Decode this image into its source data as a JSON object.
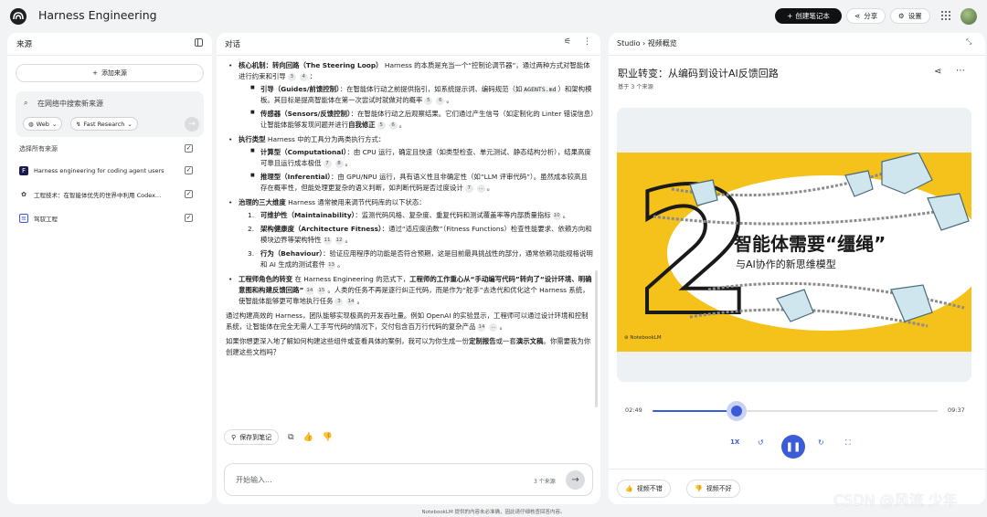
{
  "header": {
    "app_title": "Harness Engineering",
    "create_label": "创建笔记本",
    "share_label": "分享",
    "settings_label": "设置"
  },
  "sources": {
    "title": "来源",
    "add_label": "添加来源",
    "search_text": "在网络中搜索新来源",
    "web_chip": "Web",
    "research_chip": "Fast Research",
    "select_all": "选择所有来源",
    "items": [
      {
        "label": "Harness engineering for coding agent users",
        "icon": "file-icon"
      },
      {
        "label": "工程技术：在智能体优先的世界中利用 Codex...",
        "icon": "openai-icon"
      },
      {
        "label": "驾驭工程",
        "icon": "doc-icon"
      }
    ]
  },
  "chat": {
    "title": "对话",
    "b1_title": "核心机制：转向回路（The Steering Loop）",
    "b1_text": "Harness 的本质是充当一个“控制论调节器”，通过两种方式对智能体进行约束和引导",
    "b1_refs": [
      "3",
      "4"
    ],
    "b1_s1_title": "引导（Guides/前馈控制）",
    "b1_s1_text_a": "：在智能体行动之前提供指引，如系统提示词、编码规范（如",
    "b1_s1_code": "AGENTS.md",
    "b1_s1_text_b": "）和架构模板。其目标是提高智能体在第一次尝试时就做对的概率",
    "b1_s1_refs": [
      "5",
      "6"
    ],
    "b1_s2_title": "传感器（Sensors/反馈控制）",
    "b1_s2_text_a": "：在智能体行动之后观察结果。它们通过产生信号（如定制化的 Linter 错误信息）让智能体能够发现问题并进行",
    "b1_s2_bold": "自我修正",
    "b1_s2_refs": [
      "5",
      "6"
    ],
    "b2_title": "执行类型",
    "b2_text": " Harness 中的工具分为两类执行方式：",
    "b2_s1_title": "计算型（Computational）",
    "b2_s1_text": "：由 CPU 运行，确定且快速（如类型检查、单元测试、静态结构分析），结果高度可靠且运行成本极低",
    "b2_s1_refs": [
      "7",
      "8"
    ],
    "b2_s2_title": "推理型（Inferential）",
    "b2_s2_text": "：由 GPU/NPU 运行，具有语义性且非确定性（如“LLM 评审代码”）。虽然成本较高且存在概率性，但能处理更复杂的语义判断，如判断代码是否过度设计",
    "b2_s2_refs": [
      "7",
      "..."
    ],
    "b3_title": "治理的三大维度",
    "b3_text": " Harness 通常被用来调节代码库的以下状态：",
    "b3_items": [
      {
        "num": "1.",
        "title": "可维护性（Maintainability）",
        "text": "：监测代码风格、复杂度、重复代码和测试覆盖率等内部质量指标",
        "refs": [
          "10"
        ]
      },
      {
        "num": "2.",
        "title": "架构健康度（Architecture Fitness）",
        "text": "：通过“适应度函数”（Fitness Functions）检查性能要求、依赖方向和模块边界等架构特性",
        "refs": [
          "11",
          "12"
        ]
      },
      {
        "num": "3.",
        "title": "行为（Behaviour）",
        "text": "：验证应用程序的功能是否符合预期，这是目前最具挑战性的部分，通常依赖功能规格说明和 AI 生成的测试套件",
        "refs": [
          "13"
        ]
      }
    ],
    "b4_title": "工程师角色的转变",
    "b4_text_a": " 在 Harness Engineering 的范式下，",
    "b4_bold": "工程师的工作重心从“手动编写代码”转向了“设计环境、明确意图和构建反馈回路”",
    "b4_refs_a": [
      "14",
      "15"
    ],
    "b4_text_b": "。人类的任务不再是逐行纠正代码，而是作为“舵手”去迭代和优化这个 Harness 系统，使智能体能够更可靠地执行任务",
    "b4_refs_b": [
      "3",
      "14"
    ],
    "p1_text": "通过构建高效的 Harness，团队能够实现极高的开发吞吐量。例如 OpenAI 的实验显示，工程师可以通过设计环境和控制系统，让智能体在完全无需人工手写代码的情况下，交付包含百万行代码的复杂产品",
    "p1_refs": [
      "14",
      "..."
    ],
    "p2_text_a": "如果你想更深入地了解如何构建这些组件或查看具体的案例，我可以为你生成一份",
    "p2_bold_a": "定制报告",
    "p2_text_b": "或一套",
    "p2_bold_b": "演示文稿",
    "p2_text_c": "。你需要我为你创建这些文档吗？",
    "save_note": "保存到笔记",
    "input_placeholder": "开始输入...",
    "source_count": "3 个来源"
  },
  "studio": {
    "crumb_root": "Studio",
    "crumb_leaf": "视频概览",
    "title": "职业转变：从编码到设计AI反馈回路",
    "subtitle": "基于 3 个来源",
    "thumb_big": "智能体需要“缰绳”",
    "thumb_small": "与AI协作的新思维模型",
    "thumb_brand": "NotebookLM",
    "time_current": "02:49",
    "time_total": "09:37",
    "progress_fraction": 0.294,
    "speed": "1X",
    "like_label": "视频不错",
    "dislike_label": "视频不好"
  },
  "footer": "NotebookLM 提供的内容未必准确，因此请仔细核查回答内容。",
  "watermark": "CSDN @风流 少年",
  "colors": {
    "accent": "#3c5bd6",
    "thumb_yellow": "#f4c21a"
  }
}
